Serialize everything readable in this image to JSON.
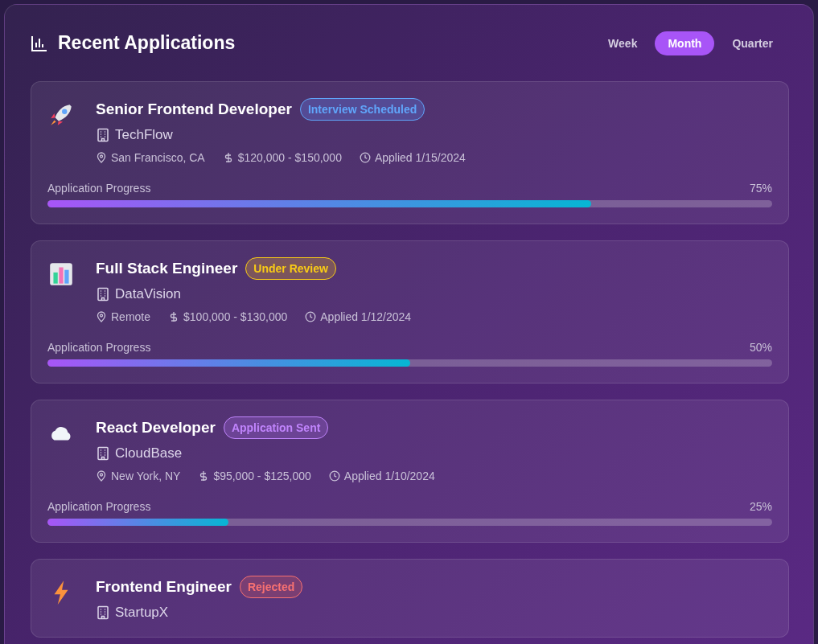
{
  "title": "Recent Applications",
  "periods": [
    {
      "label": "Week",
      "selected": false
    },
    {
      "label": "Month",
      "selected": true
    },
    {
      "label": "Quarter",
      "selected": false
    }
  ],
  "applications": [
    {
      "kind": "rocket",
      "title": "Senior Frontend Developer",
      "status": "Interview Scheduled",
      "color": "#60a5fa",
      "company": "TechFlow",
      "location": "San Francisco, CA",
      "salary": "$120,000 - $150,000",
      "applied": "Applied 1/15/2024",
      "progress_label": "Application Progress",
      "progress_text": "75%",
      "level": 0.75
    },
    {
      "kind": "chart",
      "title": "Full Stack Engineer",
      "status": "Under Review",
      "color": "#facc15",
      "company": "DataVision",
      "location": "Remote",
      "salary": "$100,000 - $130,000",
      "applied": "Applied 1/12/2024",
      "progress_label": "Application Progress",
      "progress_text": "50%",
      "level": 0.5
    },
    {
      "kind": "cloud",
      "title": "React Developer",
      "status": "Application Sent",
      "color": "#c084fc",
      "company": "CloudBase",
      "location": "New York, NY",
      "salary": "$95,000 - $125,000",
      "applied": "Applied 1/10/2024",
      "progress_label": "Application Progress",
      "progress_text": "25%",
      "level": 0.25
    },
    {
      "kind": "bolt",
      "title": "Frontend Engineer",
      "status": "Rejected",
      "color": "#f87171",
      "company": "StartupX"
    }
  ]
}
